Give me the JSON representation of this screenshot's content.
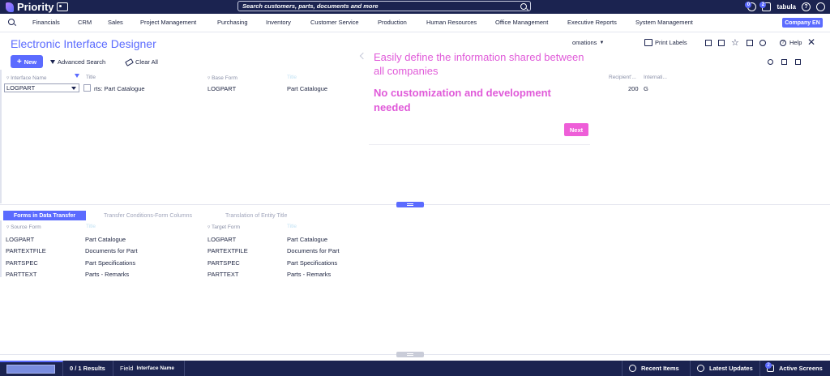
{
  "topbar": {
    "app_name": "Priority",
    "search_placeholder": "Search customers, parts, documents and more",
    "notif_count": "0",
    "msg_count": "2",
    "user": "tabula"
  },
  "menu": {
    "items": [
      "Financials",
      "CRM",
      "Sales",
      "Project Management",
      "Purchasing",
      "Inventory",
      "Customer Service",
      "Production",
      "Human Resources",
      "Office Management",
      "Executive Reports",
      "System Management"
    ],
    "company": "Company EN"
  },
  "form": {
    "title": "Electronic Interface Designer",
    "new_label": "New",
    "advanced_search": "Advanced Search",
    "clear_all": "Clear All",
    "automations": "omations",
    "print_labels": "Print Labels",
    "help": "Help"
  },
  "grid": {
    "headers": [
      "Interface Name",
      "Title",
      "Base Form",
      "Title",
      "Recipient'...",
      "Internati..."
    ],
    "row": {
      "interface_name": "LOGPART",
      "title": "rts: Part Catalogue",
      "base_form": "LOGPART",
      "base_title": "Part Catalogue",
      "recipient": "200",
      "internal": "G"
    }
  },
  "tip": {
    "line1": "Easily define the information shared between all companies",
    "line2": "No customization and development needed",
    "next": "Next"
  },
  "subforms": {
    "tabs": [
      "Forms in Data Transfer",
      "Transfer Conditions-Form Columns",
      "Translation of Entity Title"
    ],
    "headers": [
      "Source Form",
      "Title",
      "Target Form",
      "Title"
    ],
    "rows": [
      {
        "source": "LOGPART",
        "title": "Part Catalogue",
        "target": "LOGPART",
        "target_title": "Part Catalogue"
      },
      {
        "source": "PARTEXTFILE",
        "title": "Documents for Part",
        "target": "PARTEXTFILE",
        "target_title": "Documents for Part"
      },
      {
        "source": "PARTSPEC",
        "title": "Part Specifications",
        "target": "PARTSPEC",
        "target_title": "Part Specifications"
      },
      {
        "source": "PARTTEXT",
        "title": "Parts - Remarks",
        "target": "PARTTEXT",
        "target_title": "Parts - Remarks"
      }
    ]
  },
  "status": {
    "results": "0 / 1 Results",
    "field_label": "Field",
    "field_value": "Interface Name",
    "recent": "Recent Items",
    "updates": "Latest Updates",
    "active": "Active Screens",
    "active_count": "2"
  },
  "colors": {
    "accent": "#5b6bff",
    "topbar": "#1b2350",
    "tip_text": "#e05ad9",
    "tip_button": "#ee5ed8"
  }
}
